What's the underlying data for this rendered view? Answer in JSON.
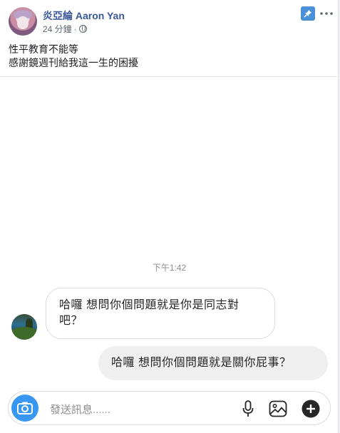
{
  "post": {
    "author": "炎亞綸 Aaron Yan",
    "time": "24 分鐘",
    "separator": "·",
    "audience_icon": "globe-icon",
    "caption_line1": "性平教育不能等",
    "caption_line2": "感謝鏡週刊給我這一生的困擾",
    "pin_icon": "pin-icon",
    "more_icon": "more-icon"
  },
  "chat": {
    "timestamp": "下午1:42",
    "incoming_message": "哈囉 想問你個問題就是你是同志對吧？",
    "outgoing_message": "哈囉 想問你個問題就是關你屁事？"
  },
  "composer": {
    "placeholder": "發送訊息......",
    "camera_icon": "camera-icon",
    "mic_icon": "microphone-icon",
    "gallery_icon": "image-icon",
    "add_icon": "plus-icon"
  },
  "colors": {
    "author_link": "#385898",
    "pin_badge": "#4a90d9",
    "camera_button": "#3897f0",
    "outgoing_bubble": "#efefef"
  }
}
